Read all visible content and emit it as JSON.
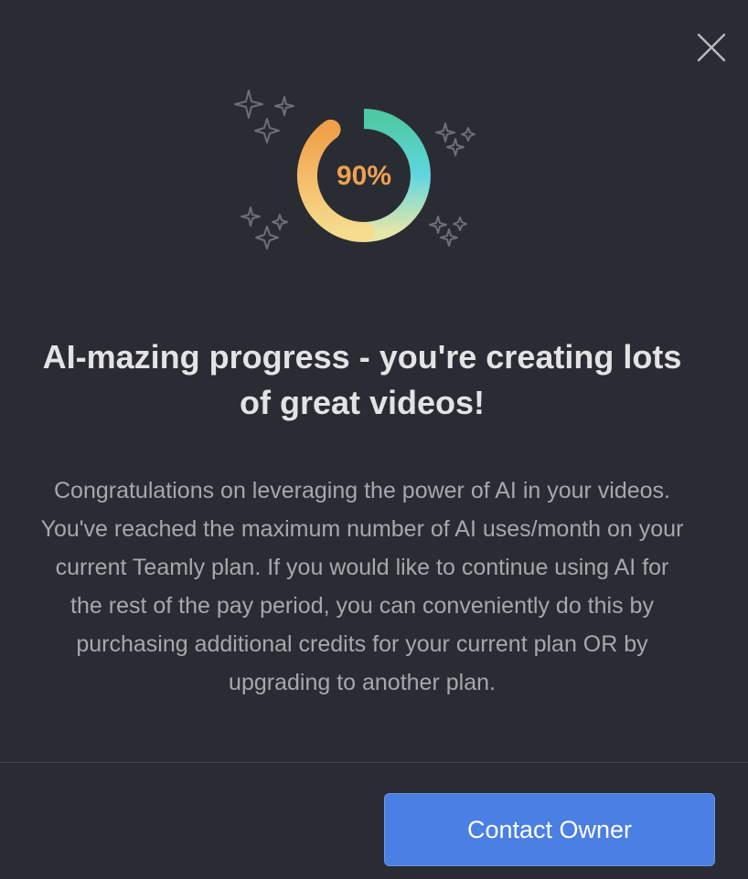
{
  "dialog": {
    "close_icon": "close-icon",
    "progress": {
      "label": "90%",
      "value": 0.9,
      "gradient_colors": [
        "#f2a04a",
        "#f5d98a",
        "#5fd6d8",
        "#4ec9a5"
      ],
      "text_color": "#f0a04f"
    },
    "decorations": "sparkle-icon",
    "title": "AI-mazing progress - you're creating lots of great videos!",
    "body": "Congratulations on leveraging the power of AI in your videos. You've reached the maximum number of AI uses/month on your current Teamly plan. If you would like to continue using AI for the rest of the pay period, you can conveniently do this by purchasing additional credits for your current plan OR by upgrading to another plan.",
    "primary_button": "Contact Owner",
    "accent_color": "#4a7fe3"
  }
}
